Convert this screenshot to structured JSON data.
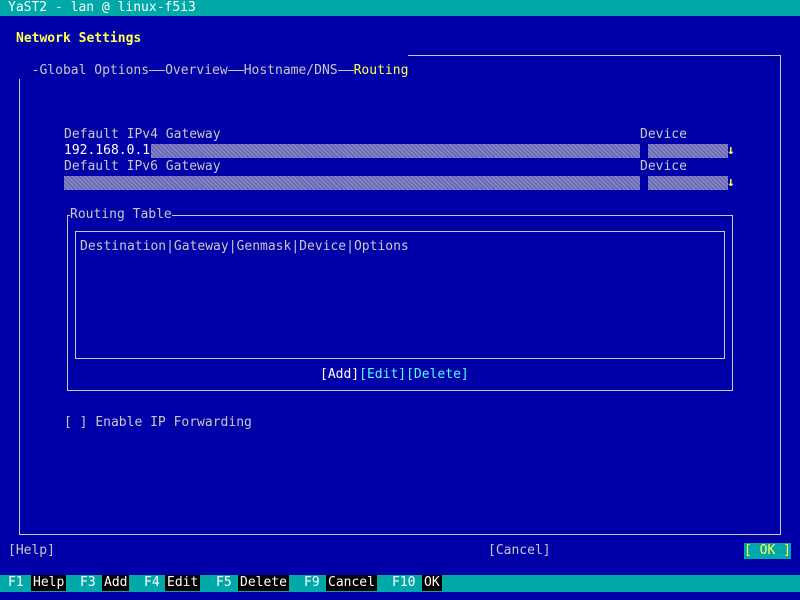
{
  "window": {
    "title": "YaST2 - lan @ linux-f5i3"
  },
  "dialog": {
    "title": "Network Settings"
  },
  "tabs": [
    {
      "label": "Global Options"
    },
    {
      "label": "Overview"
    },
    {
      "label": "Hostname/DNS"
    },
    {
      "label": "Routing",
      "active": true
    }
  ],
  "ipv4": {
    "label": "Default IPv4 Gateway",
    "value": "192.168.0.1",
    "device_label": "Device",
    "device_value": ""
  },
  "ipv6": {
    "label": "Default IPv6 Gateway",
    "value": "",
    "device_label": "Device",
    "device_value": ""
  },
  "routing_table": {
    "title": "Routing Table",
    "columns": [
      "Destination",
      "Gateway",
      "Genmask",
      "Device",
      "Options"
    ],
    "rows": [],
    "buttons": {
      "add": "[Add]",
      "edit": "[Edit]",
      "delete": "[Delete]"
    }
  },
  "ip_forwarding": {
    "checkbox": "[ ]",
    "label": "Enable IP Forwarding",
    "checked": false
  },
  "bottom_buttons": {
    "help": "[Help]",
    "cancel": "[Cancel]",
    "ok": "[ OK ]"
  },
  "fkeys": [
    {
      "key": "F1",
      "label": "Help"
    },
    {
      "key": "F3",
      "label": "Add"
    },
    {
      "key": "F4",
      "label": "Edit"
    },
    {
      "key": "F5",
      "label": "Delete"
    },
    {
      "key": "F9",
      "label": "Cancel"
    },
    {
      "key": "F10",
      "label": "OK"
    }
  ],
  "colors": {
    "background": "#0000a8",
    "bar": "#00a8a8",
    "highlight": "#ffff54"
  }
}
